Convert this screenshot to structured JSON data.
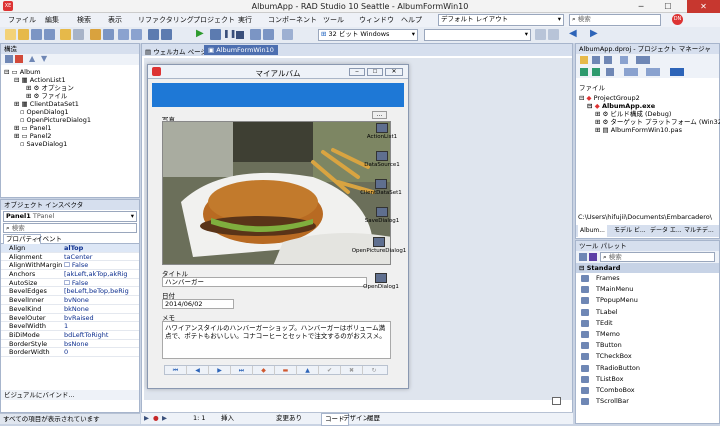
{
  "window": {
    "title": "AlbumApp - RAD Studio 10 Seattle - AlbumFormWin10",
    "app_icon": "XE"
  },
  "menu": [
    "ファイル",
    "編集",
    "検索",
    "表示",
    "リファクタリング",
    "プロジェクト",
    "実行",
    "コンポーネント",
    "ツール",
    "ウィンドウ",
    "ヘルプ"
  ],
  "toolbar": {
    "layout_value": "デフォルト レイアウト",
    "platform_value": "32 ビット Windows",
    "search_placeholder": "検索"
  },
  "structure": {
    "title": "構造",
    "tree": [
      {
        "label": "Album",
        "level": 0
      },
      {
        "label": "ActionList1",
        "level": 1
      },
      {
        "label": "オプション",
        "level": 2
      },
      {
        "label": "ファイル",
        "level": 2
      },
      {
        "label": "ClientDataSet1",
        "level": 1
      },
      {
        "label": "OpenDialog1",
        "level": 1
      },
      {
        "label": "OpenPictureDialog1",
        "level": 1
      },
      {
        "label": "Panel1",
        "level": 1
      },
      {
        "label": "Panel2",
        "level": 1
      },
      {
        "label": "SaveDialog1",
        "level": 1
      }
    ]
  },
  "inspector": {
    "title": "オブジェクト インスペクタ",
    "object": "Panel1",
    "type": "TPanel",
    "search_placeholder": "検索",
    "tabs": [
      "プロパティ",
      "イベント"
    ],
    "rows": [
      {
        "k": "Align",
        "v": "alTop"
      },
      {
        "k": "Alignment",
        "v": "taCenter"
      },
      {
        "k": "AlignWithMargin",
        "v": "False"
      },
      {
        "k": "Anchors",
        "v": "[akLeft,akTop,akRig"
      },
      {
        "k": "AutoSize",
        "v": "False"
      },
      {
        "k": "BevelEdges",
        "v": "[beLeft,beTop,beRig"
      },
      {
        "k": "BevelInner",
        "v": "bvNone"
      },
      {
        "k": "BevelKind",
        "v": "bkNone"
      },
      {
        "k": "BevelOuter",
        "v": "bvRaised"
      },
      {
        "k": "BevelWidth",
        "v": "1"
      },
      {
        "k": "BiDiMode",
        "v": "bdLeftToRight"
      },
      {
        "k": "BorderStyle",
        "v": "bsNone"
      },
      {
        "k": "BorderWidth",
        "v": "0"
      }
    ],
    "footer": "ビジュアルにバインド...",
    "status": "すべての項目が表示されています"
  },
  "editor": {
    "tabs": [
      "ウェルカム ページ",
      "AlbumFormWin10"
    ],
    "form": {
      "title": "マイアルバム",
      "photo_label": "写真",
      "ellipsis": "...",
      "title_label": "タイトル",
      "title_value": "ハンバーガー",
      "date_label": "日付",
      "date_value": "2014/06/02",
      "memo_label": "メモ",
      "memo_value": "ハワイアンスタイルのハンバーガーショップ。ハンバーガーはボリューム満点で、ポテトもおいしい。コナコーヒーとセットで注文するのがおススメ。",
      "components": [
        "ActionList1",
        "DataSource1",
        "ClientDataSet1",
        "SaveDialog1",
        "OpenPictureDialog1"
      ],
      "opendialog": "OpenDialog1",
      "nav_glyphs": [
        "⏮",
        "◀",
        "▶",
        "⏭",
        "◆",
        "▬",
        "▲",
        "✔",
        "✖",
        "↻"
      ]
    },
    "status": {
      "pos": "1: 1",
      "mode": "挿入",
      "state": "変更あり",
      "tabs": [
        "コード",
        "デザイン",
        "履歴"
      ]
    }
  },
  "project": {
    "title": "AlbumApp.dproj - プロジェクト マネージャ",
    "file_label": "ファイル",
    "tree": [
      {
        "label": "ProjectGroup2",
        "level": 0
      },
      {
        "label": "AlbumApp.exe",
        "level": 1
      },
      {
        "label": "ビルド構成 (Debug)",
        "level": 2
      },
      {
        "label": "ターゲット プラットフォーム (Win32)",
        "level": 2
      },
      {
        "label": "AlbumFormWin10.pas",
        "level": 2
      }
    ],
    "path": "C:\\Users\\hifujii\\Documents\\Embarcadero\\",
    "tabs": [
      "Album...",
      "モデル ビ...",
      "データ エ...",
      "マルチデ..."
    ]
  },
  "palette": {
    "title": "ツール パレット",
    "search_placeholder": "検索",
    "category": "Standard",
    "items": [
      "Frames",
      "TMainMenu",
      "TPopupMenu",
      "TLabel",
      "TEdit",
      "TMemo",
      "TButton",
      "TCheckBox",
      "TRadioButton",
      "TListBox",
      "TComboBox",
      "TScrollBar"
    ]
  }
}
